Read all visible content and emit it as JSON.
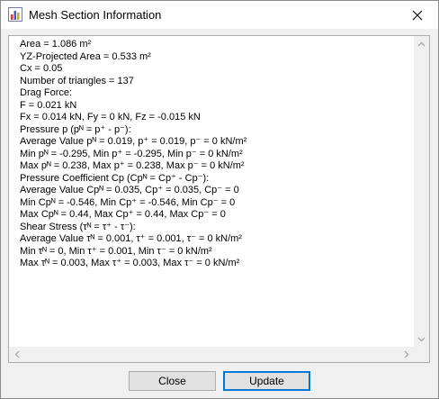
{
  "window": {
    "title": "Mesh Section Information"
  },
  "info_lines": [
    "Area = 1.086 m²",
    "YZ-Projected Area = 0.533 m²",
    "Cx = 0.05",
    "Number of triangles = 137",
    "Drag Force:",
    "F = 0.021 kN",
    "Fx = 0.014 kN, Fy = 0 kN, Fz = -0.015 kN",
    "Pressure p (pᴺ = p⁺ - p⁻):",
    "Average Value pᴺ = 0.019, p⁺ = 0.019, p⁻ = 0 kN/m²",
    "Min pᴺ = -0.295, Min p⁺ = -0.295, Min p⁻ = 0 kN/m²",
    "Max pᴺ = 0.238, Max p⁺ = 0.238, Max p⁻ = 0 kN/m²",
    "Pressure Coefficient Cp (Cpᴺ = Cp⁺ - Cp⁻):",
    "Average Value Cpᴺ = 0.035, Cp⁺ = 0.035, Cp⁻ = 0",
    "Min Cpᴺ = -0.546, Min Cp⁺ = -0.546, Min Cp⁻ = 0",
    "Max Cpᴺ = 0.44, Max Cp⁺ = 0.44, Max Cp⁻ = 0",
    "Shear Stress (τᴺ = τ⁺ - τ⁻):",
    "Average Value τᴺ = 0.001, τ⁺ = 0.001, τ⁻ = 0 kN/m²",
    "Min τᴺ = 0, Min τ⁺ = 0.001, Min τ⁻ = 0 kN/m²",
    "Max τᴺ = 0.003, Max τ⁺ = 0.003, Max τ⁻ = 0 kN/m²"
  ],
  "buttons": {
    "close_label": "Close",
    "update_label": "Update"
  },
  "icons": {
    "app": "chart-app-icon",
    "close": "close-icon"
  },
  "colors": {
    "focus_border": "#0078d7",
    "button_face": "#e1e1e1",
    "dialog_background": "#f0f0f0"
  }
}
